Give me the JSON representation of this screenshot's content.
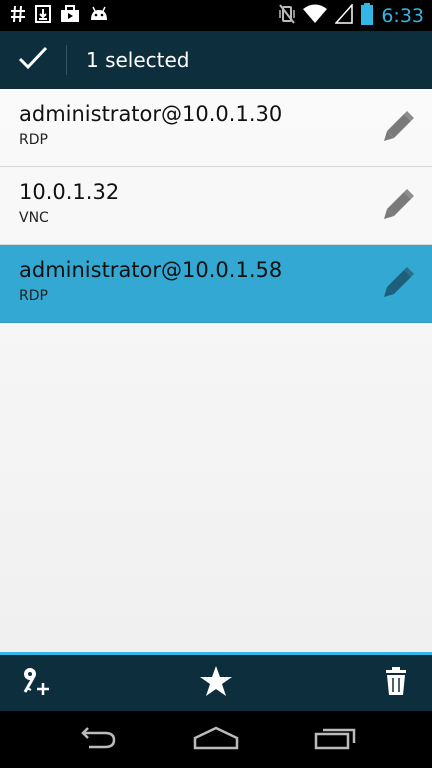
{
  "status_bar": {
    "left_icons": [
      "hash-icon",
      "download-icon",
      "briefcase-icon",
      "android-icon"
    ],
    "right_icons": [
      "vibrate-icon",
      "wifi-icon",
      "signal-icon",
      "battery-icon"
    ],
    "time": "6:33"
  },
  "action_bar": {
    "done_icon": "checkmark-icon",
    "title": "1 selected"
  },
  "connections": [
    {
      "name": "administrator@10.0.1.30",
      "protocol": "RDP",
      "selected": false
    },
    {
      "name": "10.0.1.32",
      "protocol": "VNC",
      "selected": false
    },
    {
      "name": "administrator@10.0.1.58",
      "protocol": "RDP",
      "selected": true
    }
  ],
  "bottom_actions": [
    "add-key-icon",
    "star-icon",
    "trash-icon"
  ],
  "nav": [
    "back-icon",
    "home-icon",
    "recent-apps-icon"
  ],
  "colors": {
    "accent": "#33b5e5",
    "action_bar": "#0d2e3c",
    "selected_row": "#33a8d3"
  }
}
